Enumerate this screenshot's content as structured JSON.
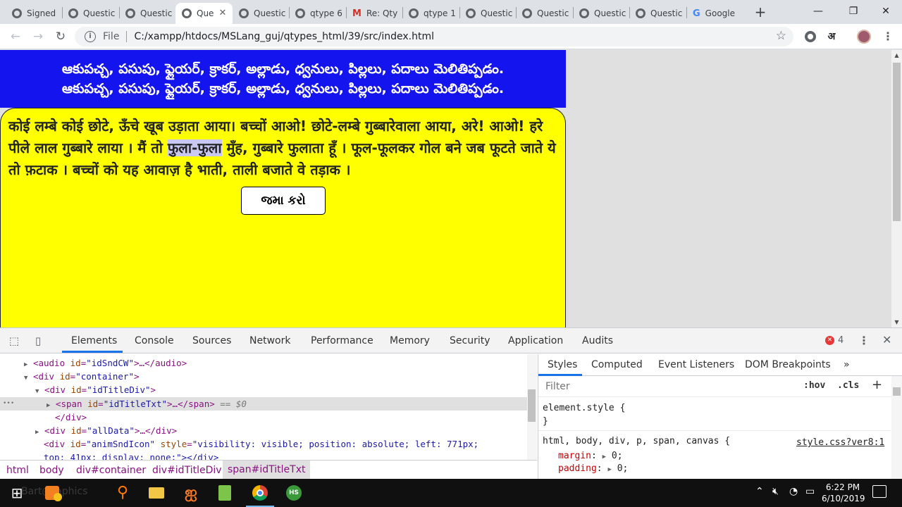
{
  "browser": {
    "tabs": [
      {
        "title": "Signed",
        "icon": "globe-icon"
      },
      {
        "title": "Questic",
        "icon": "globe-icon"
      },
      {
        "title": "Questic",
        "icon": "globe-icon"
      },
      {
        "title": "Que",
        "icon": "globe-icon",
        "active": true
      },
      {
        "title": "Questic",
        "icon": "globe-icon"
      },
      {
        "title": "qtype 6",
        "icon": "globe-icon"
      },
      {
        "title": "Re: Qty",
        "icon": "gmail-icon"
      },
      {
        "title": "qtype 1",
        "icon": "globe-icon"
      },
      {
        "title": "Questic",
        "icon": "globe-icon"
      },
      {
        "title": "Questic",
        "icon": "globe-icon"
      },
      {
        "title": "Questic",
        "icon": "globe-icon"
      },
      {
        "title": "Questic",
        "icon": "globe-icon"
      },
      {
        "title": "Google",
        "icon": "google-icon"
      }
    ],
    "new_tab": "+",
    "window_controls": {
      "minimize": "—",
      "restore": "❐",
      "close": "✕"
    },
    "toolbar": {
      "back": "←",
      "forward": "→",
      "reload": "↻",
      "info": "i",
      "file_label": "File",
      "url": "C:/xampp/htdocs/MSLang_guj/qtypes_html/39/src/index.html",
      "star": "☆",
      "hindi_ext": "अ",
      "menu": "⋮"
    }
  },
  "page": {
    "title_lines": [
      "ఆకుపచ్చ, పసుపు, ఫ్లైయర్, క్రాకర్, అల్లాడు, ధ్వనులు, పిల్లలు, పదాలు మెలితిప్పడం.",
      "ఆకుపచ్చ, పసుపు, ఫ్లైయర్, క్రాకర్, అల్లాడు, ధ్వనులు, పిల్లలు, పదాలు మెలితిప్పడం."
    ],
    "question_before": "कोई लम्बे कोई छोटे, ऊँचे खूब उड़ाता आया। बच्चों आओ! छोटे-लम्बे गुब्बारेवाला आया, अरे! आओ! हरे पीले लाल गुब्बारे लाया । मैं तो ",
    "question_highlight": "फुला-फुला",
    "question_after": " मुँह, गुब्बारे फुलाता हूँ । फूल-फूलकर गोल बने जब फूटते जाते ये तो फ़टाक । बच्चों को यह आवाज़ है भाती, ताली बजाते वे तड़ाक ।",
    "submit_label": "જમા કરો",
    "colors": {
      "title_bg": "#1414ef",
      "content_bg": "#ffff00"
    }
  },
  "devtools": {
    "tabs": [
      "Elements",
      "Console",
      "Sources",
      "Network",
      "Performance",
      "Memory",
      "Security",
      "Application",
      "Audits"
    ],
    "active_tab": "Elements",
    "error_count": "4",
    "dom": {
      "line1": {
        "tag_open": "<audio ",
        "attr": "id",
        "val": "\"idSndCW\"",
        "rest": ">…</audio>"
      },
      "line2": {
        "tag_open": "<div ",
        "attr": "id",
        "val": "\"container\"",
        "rest": ">"
      },
      "line3": {
        "tag_open": "<div ",
        "attr": "id",
        "val": "\"idTitleDiv\"",
        "rest": ">"
      },
      "line4": {
        "tag_open": "<span ",
        "attr": "id",
        "val": "\"idTitleTxt\"",
        "rest": ">…</span>",
        "suffix": " == $0"
      },
      "line5": {
        "text": "</div>"
      },
      "line6": {
        "tag_open": "<div ",
        "attr": "id",
        "val": "\"allData\"",
        "rest": ">…</div>"
      },
      "line7": {
        "tag_open": "<div ",
        "attr": "id",
        "val": "\"animSndIcon\"",
        "attr2": "style",
        "val2": "\"visibility: visible; position: absolute; left: 771px;"
      },
      "line8": {
        "text": "top: 41px; display: none;\"></div>"
      }
    },
    "breadcrumbs": [
      "html",
      "body",
      "div#container",
      "div#idTitleDiv",
      "span#idTitleTxt"
    ],
    "styles": {
      "tabs": [
        "Styles",
        "Computed",
        "Event Listeners",
        "DOM Breakpoints",
        "»"
      ],
      "filter_placeholder": "Filter",
      "hov": ":hov",
      "cls": ".cls",
      "add": "+",
      "element_style": "element.style {",
      "close_brace": "}",
      "rule_selector": "html, body, div, p, span, canvas {",
      "rule_source": "style.css?ver8:1",
      "prop1": "margin",
      "val1": "0;",
      "prop2": "padding",
      "val2": "0;"
    }
  },
  "taskbar": {
    "search_ghost": "Bart@raphics",
    "clock_time": "6:22 PM",
    "clock_date": "6/10/2019",
    "hs_label": "HS"
  }
}
